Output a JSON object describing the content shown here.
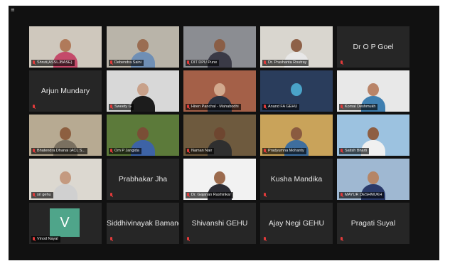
{
  "window": {
    "active_speaker": "Shruti(ASSLJBASE)"
  },
  "participants": [
    {
      "id": "p1",
      "name": "Shruti(ASSLJBASE)",
      "type": "video",
      "active": true,
      "scene": {
        "bg": "#cfc8bd",
        "skin": "#b07a5a",
        "shirt": "#c44a6a"
      }
    },
    {
      "id": "p2",
      "name": "Debendra Saini",
      "type": "video",
      "scene": {
        "bg": "#b9b4a9",
        "skin": "#9a6d52",
        "shirt": "#6f8fb5"
      }
    },
    {
      "id": "p3",
      "name": "DIT DPU Pune",
      "type": "video",
      "scene": {
        "bg": "#8b8d92",
        "skin": "#8a5e46",
        "shirt": "#3a3a46"
      }
    },
    {
      "id": "p4",
      "name": "Dr. Prashanta Routray",
      "type": "video",
      "scene": {
        "bg": "#d9d6cf",
        "skin": "#8e6148",
        "shirt": "#e8e8e8"
      }
    },
    {
      "id": "p5",
      "name": "Dr O P Goel",
      "type": "name"
    },
    {
      "id": "p6",
      "name": "Arjun Mundary",
      "type": "name"
    },
    {
      "id": "p7",
      "name": "Sweety G",
      "type": "video",
      "scene": {
        "bg": "#d8d8d8",
        "skin": "#c8a18a",
        "shirt": "#1c1c1c"
      }
    },
    {
      "id": "p8",
      "name": "Hiren Panchal - Mahabodhi",
      "type": "video",
      "scene": {
        "bg": "#a46048",
        "skin": "#d2a98e",
        "shirt": "#2b3240"
      }
    },
    {
      "id": "p9",
      "name": "Anand FA GEHU",
      "type": "video",
      "scene": {
        "bg": "#2a3d5c",
        "skin": "#4aa3c8",
        "shirt": "#2a3d5c"
      }
    },
    {
      "id": "p10",
      "name": "Komal Deshmukh",
      "type": "video",
      "scene": {
        "bg": "#e8e8e8",
        "skin": "#b98468",
        "shirt": "#3f7fb0"
      }
    },
    {
      "id": "p11",
      "name": "Bhatendra Dhanai (ACL S...",
      "type": "video",
      "scene": {
        "bg": "#b7aa92",
        "skin": "#8d5f40",
        "shirt": "#7a7060"
      }
    },
    {
      "id": "p12",
      "name": "Om P Jangida",
      "type": "video",
      "scene": {
        "bg": "#5c7a3a",
        "skin": "#7a4e36",
        "shirt": "#3d63a6"
      }
    },
    {
      "id": "p13",
      "name": "Naman Nair",
      "type": "video",
      "scene": {
        "bg": "#6e5a3e",
        "skin": "#6e4630",
        "shirt": "#2f2f2f"
      }
    },
    {
      "id": "p14",
      "name": "Pradyumna Mohanty",
      "type": "video",
      "scene": {
        "bg": "#c9a35a",
        "skin": "#8a5b40",
        "shirt": "#3e6e9e"
      }
    },
    {
      "id": "p15",
      "name": "Satish Bharti",
      "type": "video",
      "scene": {
        "bg": "#9cc2e0",
        "skin": "#8e5e42",
        "shirt": "#f0f0f0"
      }
    },
    {
      "id": "p16",
      "name": "sri gehu",
      "type": "video",
      "scene": {
        "bg": "#dcd8d0",
        "skin": "#c49a80",
        "shirt": "#d0d0d0"
      }
    },
    {
      "id": "p17",
      "name": "Prabhakar Jha",
      "type": "name"
    },
    {
      "id": "p18",
      "name": "Dr. Gajanan Rashinkar",
      "type": "video",
      "scene": {
        "bg": "#f2f2f2",
        "skin": "#9c6b4e",
        "shirt": "#2c2c34"
      }
    },
    {
      "id": "p19",
      "name": "Kusha Mandika",
      "type": "name"
    },
    {
      "id": "p20",
      "name": "MAYUR DESHMUKH",
      "type": "video",
      "scene": {
        "bg": "#9fb8d2",
        "skin": "#b58566",
        "shirt": "#2a3a6a"
      }
    },
    {
      "id": "p21",
      "name": "Vinod Nayal",
      "type": "avatar",
      "initial": "V"
    },
    {
      "id": "p22",
      "name": "Siddhivinayak Bamane",
      "type": "name"
    },
    {
      "id": "p23",
      "name": "Shivanshi GEHU",
      "type": "name"
    },
    {
      "id": "p24",
      "name": "Ajay Negi GEHU",
      "type": "name"
    },
    {
      "id": "p25",
      "name": "Pragati Suyal",
      "type": "name"
    }
  ],
  "colors": {
    "active_border": "#b8d32b",
    "muted_mic": "#e23b3b",
    "tile_bg": "#262626",
    "window_bg": "#111111",
    "avatar_bg": "#4fa58a"
  },
  "icons": {
    "muted": "muted-mic-icon"
  }
}
